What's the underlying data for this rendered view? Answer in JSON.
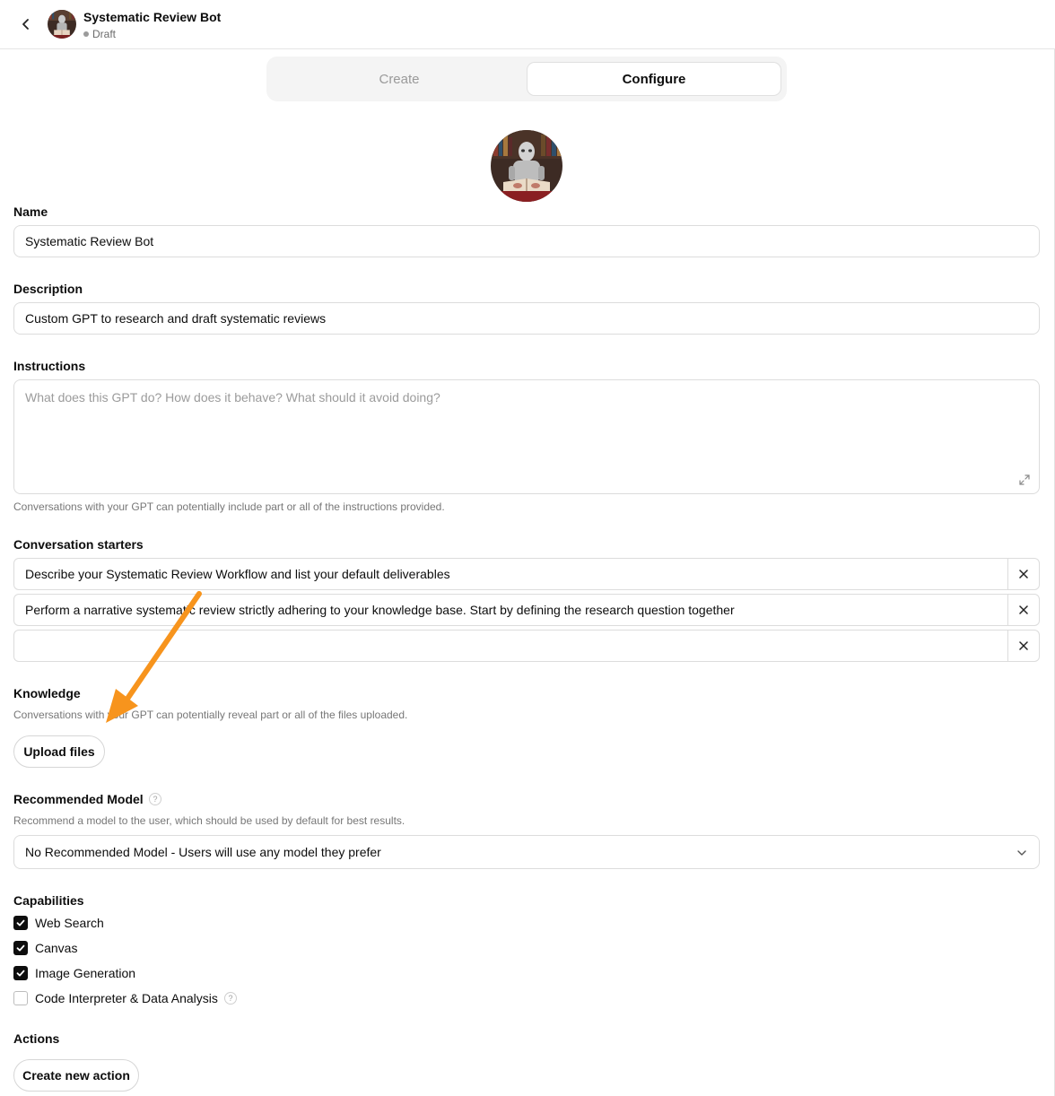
{
  "header": {
    "title": "Systematic Review Bot",
    "status": "Draft"
  },
  "tabs": {
    "create": "Create",
    "configure": "Configure"
  },
  "name": {
    "label": "Name",
    "value": "Systematic Review Bot"
  },
  "description": {
    "label": "Description",
    "value": "Custom GPT to research and draft systematic reviews"
  },
  "instructions": {
    "label": "Instructions",
    "placeholder": "What does this GPT do? How does it behave? What should it avoid doing?",
    "hint": "Conversations with your GPT can potentially include part or all of the instructions provided."
  },
  "starters": {
    "label": "Conversation starters",
    "items": [
      "Describe your Systematic Review Workflow and list your default deliverables",
      "Perform a narrative systematic review strictly adhering to your knowledge base. Start by defining the research question together",
      ""
    ]
  },
  "knowledge": {
    "label": "Knowledge",
    "hint": "Conversations with your GPT can potentially reveal part or all of the files uploaded.",
    "upload_label": "Upload files"
  },
  "model": {
    "label": "Recommended Model",
    "hint": "Recommend a model to the user, which should be used by default for best results.",
    "selected": "No Recommended Model - Users will use any model they prefer",
    "help_glyph": "?"
  },
  "capabilities": {
    "label": "Capabilities",
    "items": [
      {
        "label": "Web Search",
        "checked": true
      },
      {
        "label": "Canvas",
        "checked": true
      },
      {
        "label": "Image Generation",
        "checked": true
      },
      {
        "label": "Code Interpreter & Data Analysis",
        "checked": false
      }
    ]
  },
  "actions": {
    "label": "Actions",
    "create_label": "Create new action"
  },
  "colors": {
    "annotation_arrow": "#f7941d",
    "checkbox_checked": "#0d0d0d"
  },
  "icons": [
    "chevron-left-icon",
    "expand-icon",
    "close-icon",
    "help-icon",
    "chevron-down-icon",
    "checkmark-icon",
    "avatar-robot-reading"
  ]
}
